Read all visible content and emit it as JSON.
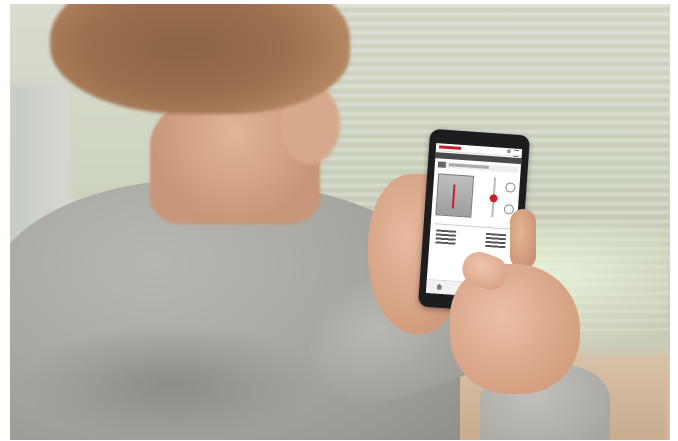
{
  "scene": {
    "colors": {
      "phone_body": "#1d1d1f",
      "app_accent": "#c8202a",
      "sweater": "#a9a7a1",
      "background": "#cdd4c1"
    }
  },
  "phone_app": {
    "icons": [
      "logo",
      "user-icon",
      "menu-icon",
      "home-icon"
    ]
  }
}
